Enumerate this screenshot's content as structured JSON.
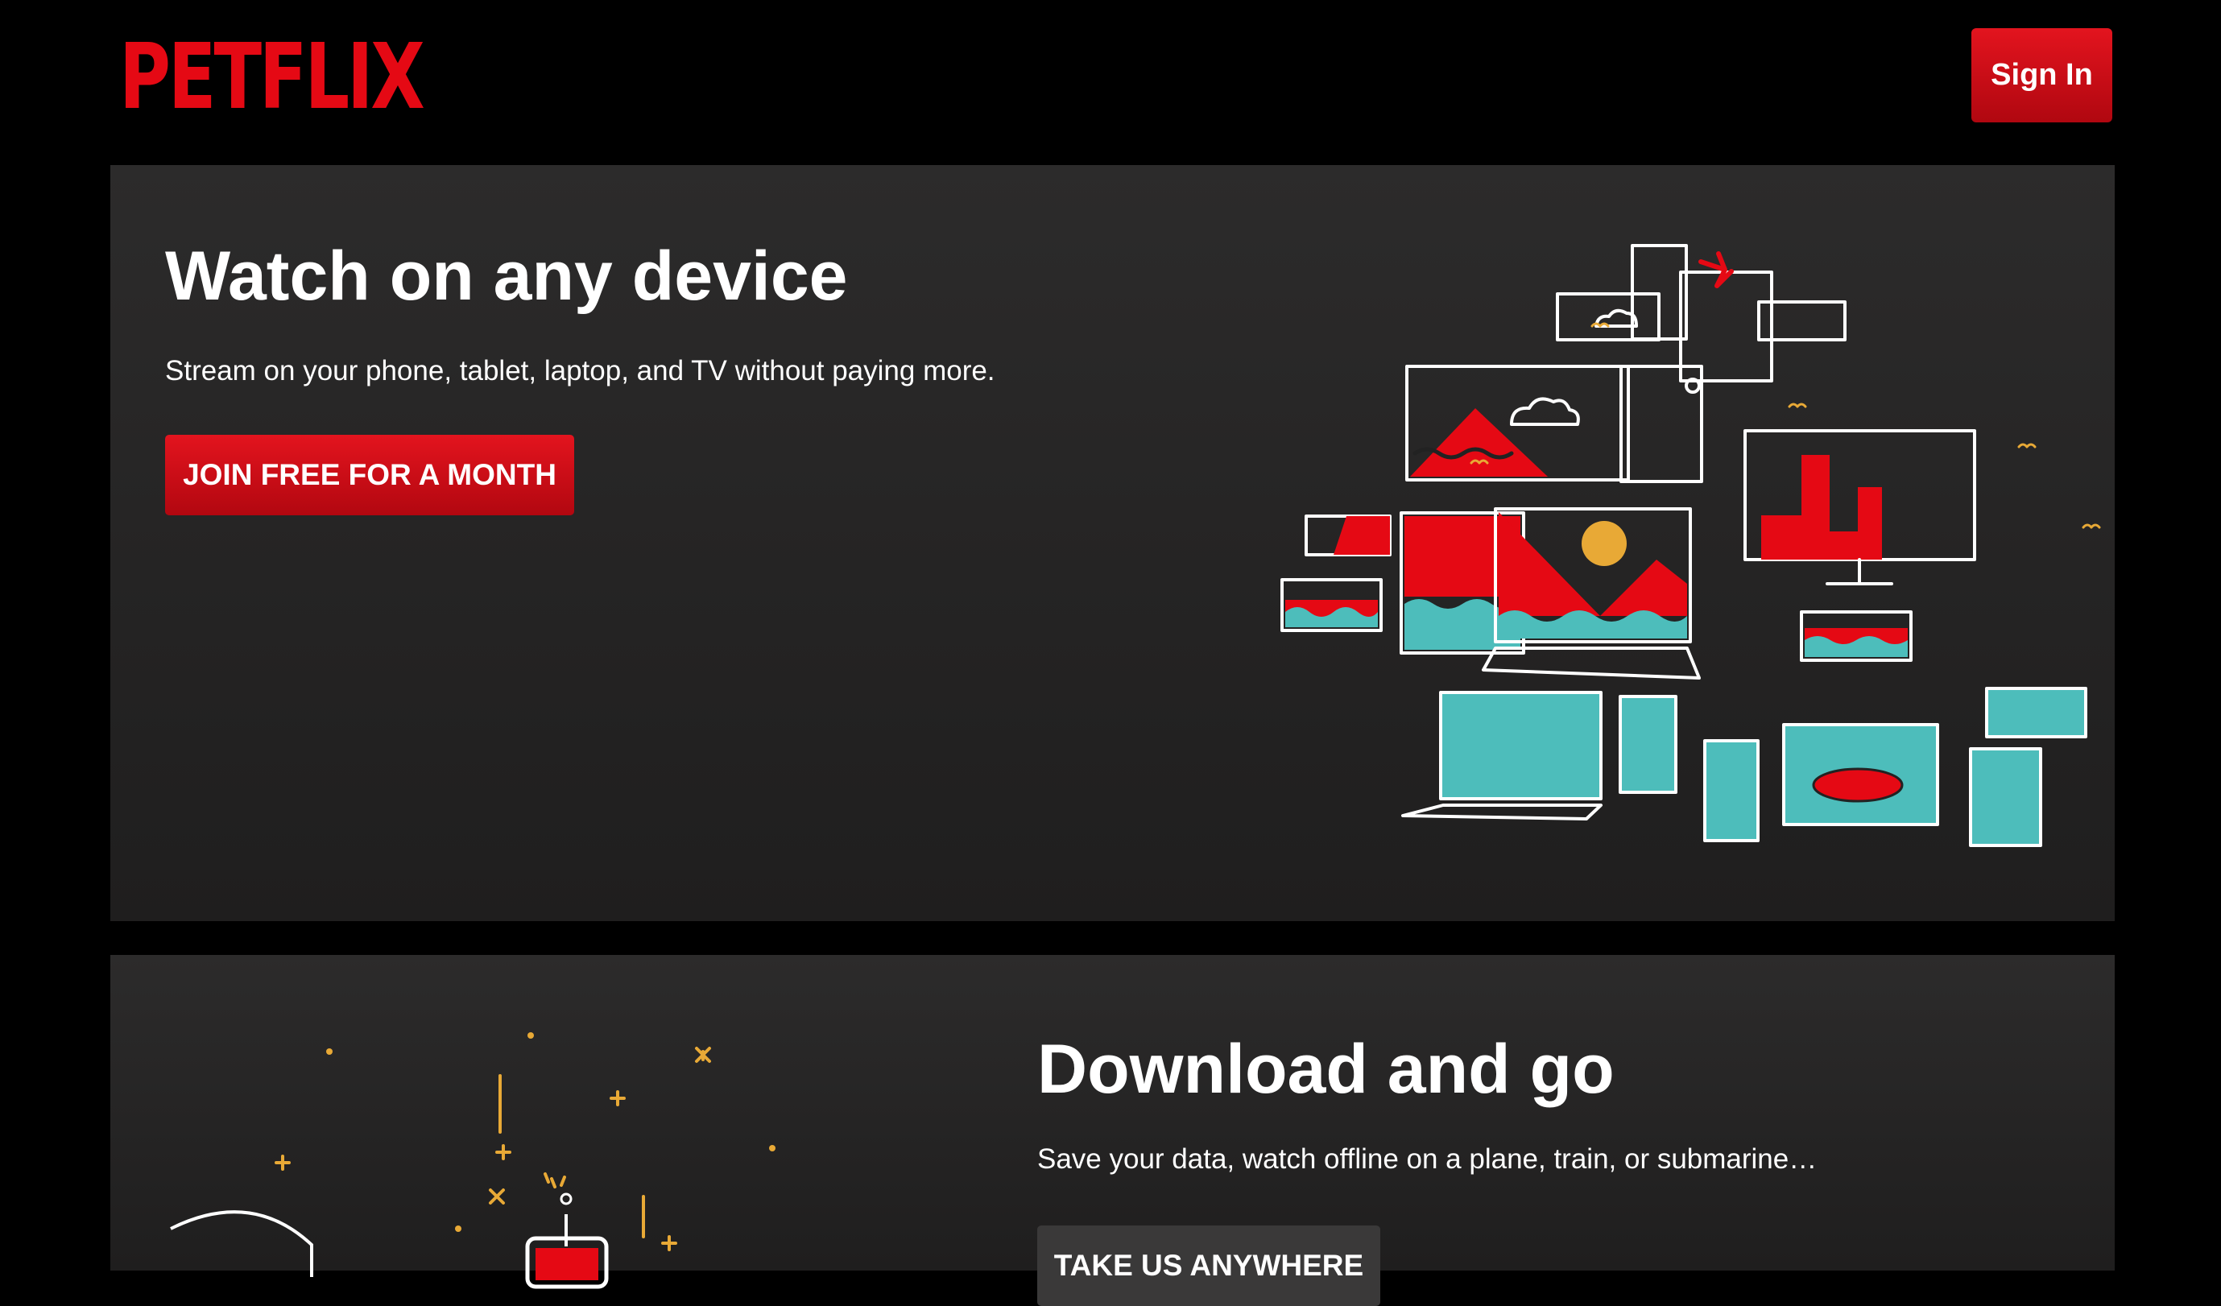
{
  "header": {
    "logo": "PETFLIX",
    "signin_label": "Sign In"
  },
  "section1": {
    "title": "Watch on any device",
    "subtitle": "Stream on your phone, tablet, laptop, and TV without paying more.",
    "cta_label": "JOIN FREE FOR A MONTH"
  },
  "section2": {
    "title": "Download and go",
    "subtitle": "Save your data, watch offline on a plane, train, or submarine…",
    "cta_label": "TAKE US ANYWHERE"
  },
  "colors": {
    "brand_red": "#e50914",
    "teal": "#4dbdbb",
    "gold": "#e8a936",
    "panel": "#262525"
  }
}
